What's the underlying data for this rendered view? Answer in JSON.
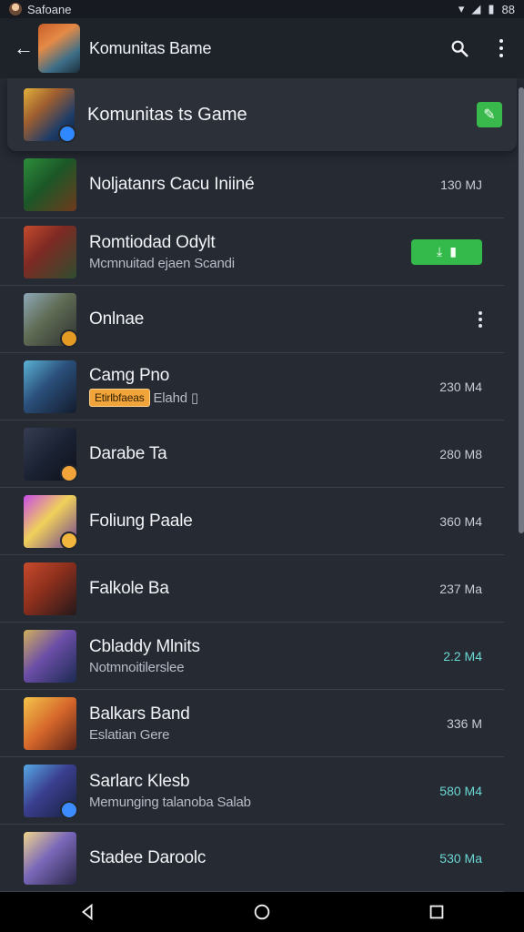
{
  "status": {
    "left_text": "Safoane",
    "right_text": "88"
  },
  "toolbar": {
    "title": "Komunitas Bame"
  },
  "featured": {
    "title": "Komunitas ts Game"
  },
  "rows": [
    {
      "title": "Noljatanrs Cacu Iniiné",
      "subtitle": "",
      "size": "130 MJ"
    },
    {
      "title": "Romtiodad Odylt",
      "subtitle": "Mcmnuitad ejaen Scandi",
      "size": ""
    },
    {
      "title": "Onlnae",
      "subtitle": "",
      "size": ""
    },
    {
      "title": "Camg Pno",
      "subtitle": "Elahd",
      "tag": "Etirlbfaeas",
      "size": "230 M4"
    },
    {
      "title": "Darabe Ta",
      "subtitle": "",
      "size": "280 M8"
    },
    {
      "title": "Foliung Paale",
      "subtitle": "",
      "size": "360 M4"
    },
    {
      "title": "Falkole Ba",
      "subtitle": "",
      "size": "237 Ma"
    },
    {
      "title": "Cbladdy Mlnits",
      "subtitle": "Notmnoitilerslee",
      "size": "2.2 M4"
    },
    {
      "title": "Balkars Band",
      "subtitle": "Eslatian Gere",
      "size": "336 M"
    },
    {
      "title": "Sarlarc Klesb",
      "subtitle": "Memunging talanoba Salab",
      "size": "580 M4"
    },
    {
      "title": "Stadee Daroolc",
      "subtitle": "",
      "size": "530 Ma"
    }
  ],
  "colors": {
    "accent_green": "#34b94b",
    "accent_orange": "#f0a43a",
    "size_teal": "#6bd7d3",
    "background": "#262a33"
  }
}
